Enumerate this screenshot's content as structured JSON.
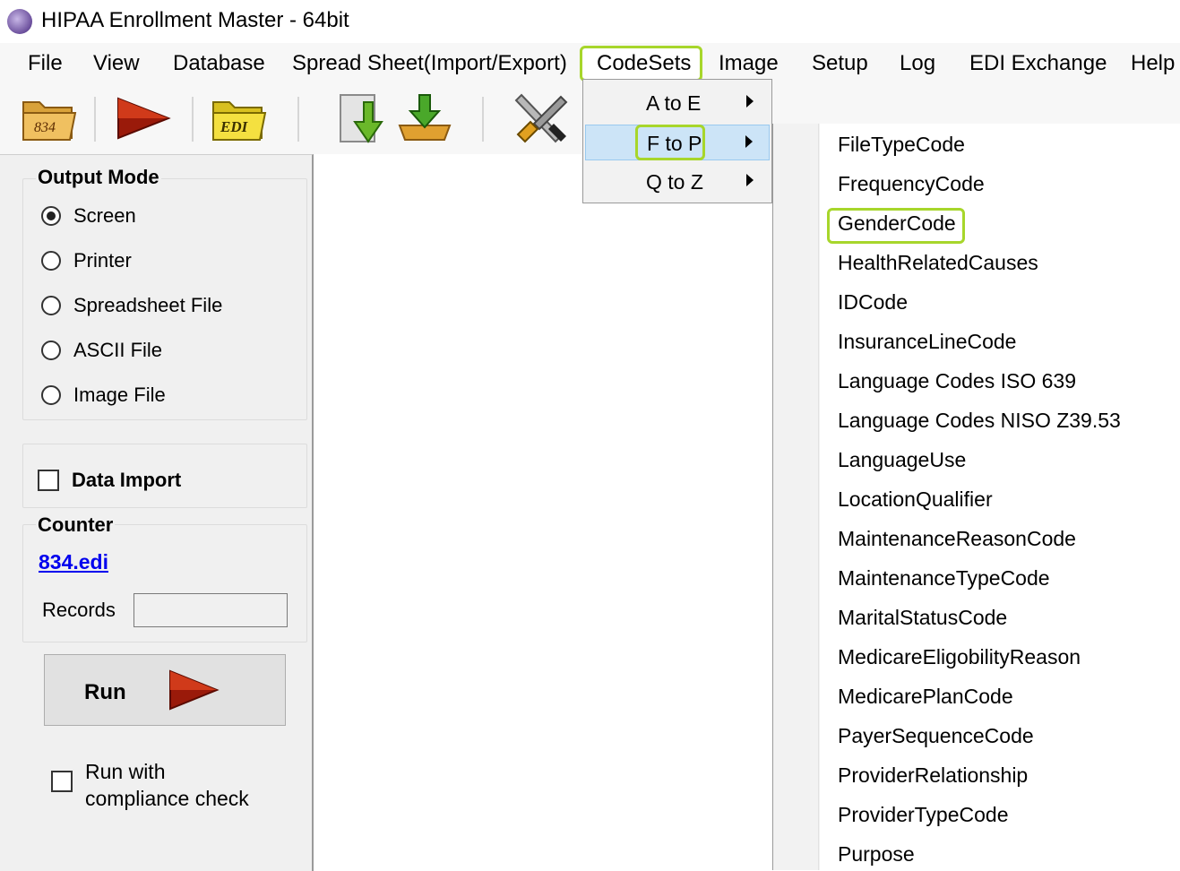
{
  "window": {
    "title": "HIPAA Enrollment Master - 64bit",
    "icon": "app-logo-icon"
  },
  "menubar": {
    "items": [
      "File",
      "View",
      "Database",
      "Spread Sheet(Import/Export)",
      "CodeSets",
      "Image",
      "Setup",
      "Log",
      "EDI Exchange",
      "Help"
    ],
    "highlighted": "CodeSets"
  },
  "toolbar": {
    "buttons": [
      {
        "icon": "folder-834-icon",
        "label": "834"
      },
      {
        "icon": "run-arrow-icon"
      },
      {
        "icon": "folder-edi-icon",
        "label": "EDI"
      },
      {
        "icon": "download-document-icon"
      },
      {
        "icon": "import-tray-icon"
      },
      {
        "icon": "tools-icon"
      }
    ]
  },
  "output_mode": {
    "title": "Output Mode",
    "options": [
      "Screen",
      "Printer",
      "Spreadsheet File",
      "ASCII File",
      "Image File"
    ],
    "selected": "Screen"
  },
  "data_import": {
    "label": "Data Import",
    "checked": false
  },
  "counter": {
    "title": "Counter",
    "file_link": "834.edi",
    "records_label": "Records",
    "records_value": ""
  },
  "run": {
    "label": "Run",
    "icon": "run-arrow-icon"
  },
  "compliance": {
    "line1": "Run with",
    "line2": "compliance check",
    "checked": false
  },
  "codesets_menu": {
    "items": [
      "A to E",
      "F to P",
      "Q to Z"
    ],
    "selected": "F to P",
    "accent": "#a7d62b",
    "selection_color": "#cce4f7"
  },
  "f_to_p_submenu": {
    "items": [
      "FileTypeCode",
      "FrequencyCode",
      "GenderCode",
      "HealthRelatedCauses",
      "IDCode",
      "InsuranceLineCode",
      "Language Codes ISO 639",
      "Language Codes NISO Z39.53",
      "LanguageUse",
      "LocationQualifier",
      "MaintenanceReasonCode",
      "MaintenanceTypeCode",
      "MaritalStatusCode",
      "MedicareEligobilityReason",
      "MedicarePlanCode",
      "PayerSequenceCode",
      "ProviderRelationship",
      "ProviderTypeCode",
      "Purpose"
    ],
    "highlighted": "GenderCode"
  }
}
